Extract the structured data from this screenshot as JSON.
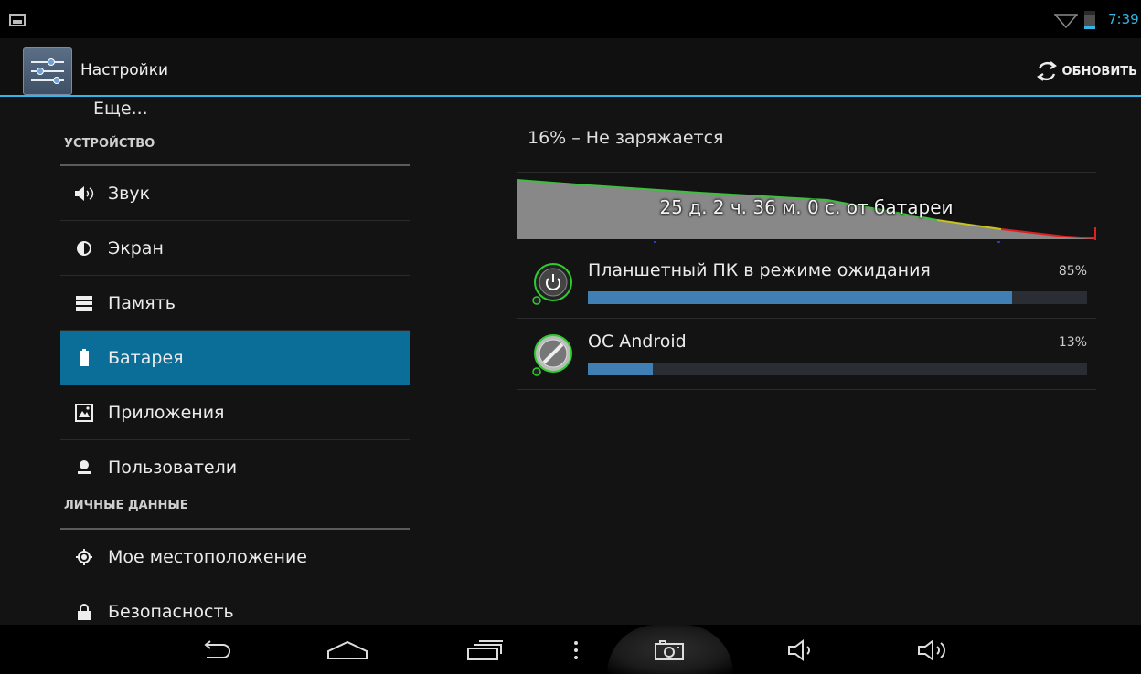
{
  "status_bar": {
    "time": "7:39",
    "battery_level_percent": 16
  },
  "action_bar": {
    "title": "Настройки",
    "refresh_label": "ОБНОВИТЬ"
  },
  "sidebar": {
    "top_item_partial": "Еще...",
    "category_device": "УСТРОЙСТВО",
    "category_personal": "ЛИЧНЫЕ ДАННЫЕ",
    "items": [
      {
        "label": "Звук",
        "icon": "speaker-icon"
      },
      {
        "label": "Экран",
        "icon": "brightness-icon"
      },
      {
        "label": "Память",
        "icon": "storage-icon"
      },
      {
        "label": "Батарея",
        "icon": "battery-icon",
        "active": true
      },
      {
        "label": "Приложения",
        "icon": "apps-icon"
      },
      {
        "label": "Пользователи",
        "icon": "user-icon"
      },
      {
        "label": "Мое местоположение",
        "icon": "location-icon"
      },
      {
        "label": "Безопасность",
        "icon": "lock-icon"
      }
    ]
  },
  "battery": {
    "status": "16% – Не заряжается",
    "graph_label": "25 д. 2 ч. 36 м. 0 с. от батареи",
    "usage": [
      {
        "label": "Планшетный ПК в режиме ожидания",
        "percent_text": "85%",
        "percent": 85,
        "icon": "power-icon"
      },
      {
        "label": "ОС Android",
        "percent_text": "13%",
        "percent": 13,
        "icon": "android-icon"
      }
    ]
  },
  "colors": {
    "accent": "#33b5e5",
    "selected": "#0b6e99",
    "bar_fill": "#3f7fb4"
  },
  "navigation": [
    "back-icon",
    "home-icon",
    "recents-icon",
    "menu-icon",
    "screenshot-icon",
    "volume-down-icon",
    "volume-up-icon"
  ]
}
